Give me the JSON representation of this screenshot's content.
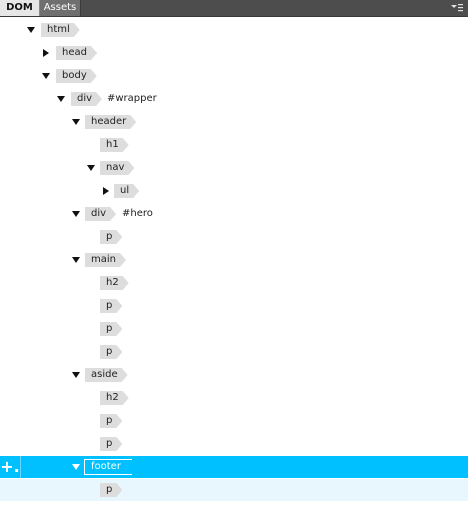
{
  "tabs": [
    {
      "label": "DOM",
      "active": true
    },
    {
      "label": "Assets",
      "active": false
    }
  ],
  "panel_menu_icon": "panel-menu-icon",
  "add_button_label": "+.",
  "accent_color": "#00c0ff",
  "tree": [
    {
      "tag": "html",
      "expanded": true
    },
    {
      "tag": "head",
      "expanded": false
    },
    {
      "tag": "body",
      "expanded": true
    },
    {
      "tag": "div",
      "id": "#wrapper",
      "expanded": true
    },
    {
      "tag": "header",
      "expanded": true
    },
    {
      "tag": "h1"
    },
    {
      "tag": "nav",
      "expanded": true
    },
    {
      "tag": "ul",
      "expanded": false
    },
    {
      "tag": "div",
      "id": "#hero",
      "expanded": true
    },
    {
      "tag": "p"
    },
    {
      "tag": "main",
      "expanded": true
    },
    {
      "tag": "h2"
    },
    {
      "tag": "p"
    },
    {
      "tag": "p"
    },
    {
      "tag": "p"
    },
    {
      "tag": "aside",
      "expanded": true
    },
    {
      "tag": "h2"
    },
    {
      "tag": "p"
    },
    {
      "tag": "p"
    },
    {
      "tag": "footer",
      "expanded": true,
      "selected": true
    },
    {
      "tag": "p"
    }
  ]
}
